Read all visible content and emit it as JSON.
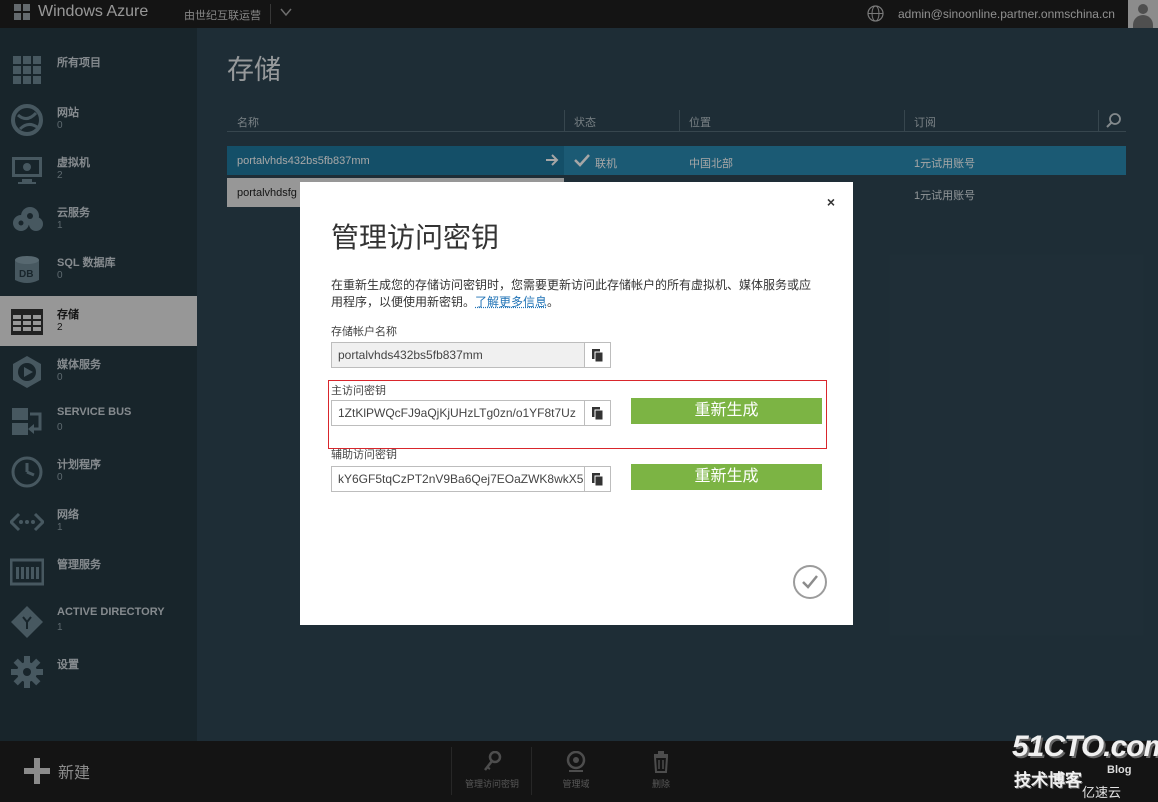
{
  "topbar": {
    "logo_text": "Windows Azure",
    "subscription": "由世纪互联运营",
    "user_email": "admin@sinoonline.partner.onmschina.cn"
  },
  "sidebar": {
    "items": [
      {
        "label": "所有项目",
        "count": ""
      },
      {
        "label": "网站",
        "count": "0"
      },
      {
        "label": "虚拟机",
        "count": "2"
      },
      {
        "label": "云服务",
        "count": "1"
      },
      {
        "label": "SQL 数据库",
        "count": "0"
      },
      {
        "label": "存储",
        "count": "2"
      },
      {
        "label": "媒体服务",
        "count": "0"
      },
      {
        "label": "SERVICE BUS",
        "count": "0"
      },
      {
        "label": "计划程序",
        "count": "0"
      },
      {
        "label": "网络",
        "count": "1"
      },
      {
        "label": "管理服务",
        "count": ""
      },
      {
        "label": "ACTIVE DIRECTORY",
        "count": "1"
      },
      {
        "label": "设置",
        "count": ""
      }
    ]
  },
  "main": {
    "title": "存储",
    "columns": [
      "名称",
      "状态",
      "位置",
      "订阅"
    ],
    "rows": [
      {
        "name": "portalvhds432bs5fb837mm",
        "status": "联机",
        "location": "中国北部",
        "subscription": "1元试用账号"
      },
      {
        "name": "portalvhdsfg",
        "status": "",
        "location": "",
        "subscription": "1元试用账号"
      }
    ]
  },
  "dialog": {
    "title": "管理访问密钥",
    "description": "在重新生成您的存储访问密钥时，您需要更新访问此存储帐户的所有虚拟机、媒体服务或应用程序，以便使用新密钥。",
    "learn_more": "了解更多信息",
    "period": "。",
    "account_label": "存储帐户名称",
    "account_value": "portalvhds432bs5fb837mm",
    "primary_label": "主访问密钥",
    "primary_value": "1ZtKlPWQcFJ9aQjKjUHzLTg0zn/o1YF8t7Uz",
    "secondary_label": "辅助访问密钥",
    "secondary_value": "kY6GF5tqCzPT2nV9Ba6Qej7EOaZWK8wkX5",
    "regenerate_label": "重新生成",
    "close_symbol": "×"
  },
  "commandbar": {
    "new_label": "新建",
    "commands": [
      "管理访问密钥",
      "管理域",
      "删除"
    ]
  },
  "watermark": {
    "site": "51CTO.com",
    "tagline": "技术博客",
    "blog": "Blog",
    "cloud": "亿速云"
  },
  "colors": {
    "accent_blue": "#2a8bb3",
    "regenerate_green": "#7cb444",
    "highlight_red": "#d9262c"
  }
}
